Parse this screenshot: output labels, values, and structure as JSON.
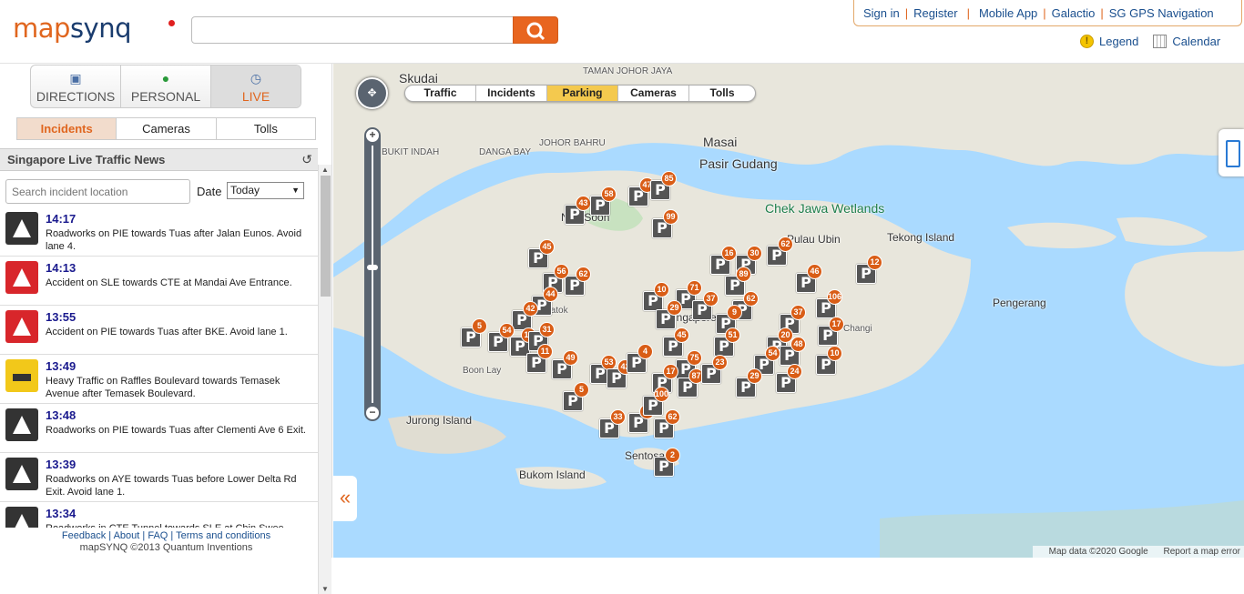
{
  "header": {
    "logo_part1": "map",
    "logo_part2": "synq",
    "search_placeholder": "",
    "links": [
      "Sign in",
      "Register",
      "Mobile App",
      "Galactio",
      "SG GPS Navigation"
    ],
    "legend_label": "Legend",
    "calendar_label": "Calendar"
  },
  "modes": [
    {
      "label": "DIRECTIONS",
      "icon": "car-icon"
    },
    {
      "label": "PERSONAL",
      "icon": "person-icon"
    },
    {
      "label": "LIVE",
      "icon": "clock-icon"
    }
  ],
  "subtabs": [
    "Incidents",
    "Cameras",
    "Tolls"
  ],
  "news": {
    "title": "Singapore Live Traffic News",
    "search_placeholder": "Search incident location",
    "date_label": "Date",
    "date_value": "Today"
  },
  "incidents": [
    {
      "time": "14:17",
      "type": "road",
      "icon": "roadworks-icon",
      "desc": "Roadworks on PIE towards Tuas after Jalan Eunos. Avoid lane 4."
    },
    {
      "time": "14:13",
      "type": "acc",
      "icon": "accident-icon",
      "desc": "Accident on SLE towards CTE at Mandai Ave Entrance."
    },
    {
      "time": "13:55",
      "type": "acc",
      "icon": "accident-icon",
      "desc": "Accident on PIE towards Tuas after BKE. Avoid lane 1."
    },
    {
      "time": "13:49",
      "type": "heavy",
      "icon": "heavy-traffic-icon",
      "desc": "Heavy Traffic on Raffles Boulevard towards Temasek Avenue after Temasek Boulevard."
    },
    {
      "time": "13:48",
      "type": "road",
      "icon": "roadworks-icon",
      "desc": "Roadworks on PIE towards Tuas after Clementi Ave 6 Exit."
    },
    {
      "time": "13:39",
      "type": "road",
      "icon": "roadworks-icon",
      "desc": "Roadworks on AYE towards Tuas before Lower Delta Rd Exit. Avoid lane 1."
    },
    {
      "time": "13:34",
      "type": "road",
      "icon": "roadworks-icon",
      "desc": "Roadworks in CTE Tunnel towards SLE at Chin Swee"
    }
  ],
  "footer": {
    "links": [
      "Feedback",
      "About",
      "FAQ",
      "Terms and conditions"
    ],
    "copyright": "mapSYNQ ©2013 Quantum Inventions"
  },
  "map": {
    "layers": [
      "Traffic",
      "Incidents",
      "Parking",
      "Cameras",
      "Tolls"
    ],
    "active_layer": "Parking",
    "places": [
      "Skudai",
      "TAMAN JOHOR JAYA",
      "Masai",
      "Pasir Gudang",
      "BUKIT INDAH",
      "DANGA BAY",
      "JOHOR BAHRU",
      "Chek Jawa Wetlands",
      "Pulau Ubin",
      "Tekong Island",
      "Pengerang",
      "Jurong Island",
      "Bukom Island",
      "Sentosa",
      "Nee Soon",
      "Singapore",
      "Changi",
      "Batok",
      "Boon Lay"
    ],
    "attribution": "Map data ©2020 Google",
    "report": "Report a map error",
    "parking_counts": [
      "43",
      "58",
      "47",
      "85",
      "99",
      "45",
      "62",
      "56",
      "44",
      "42",
      "5",
      "54",
      "19",
      "31",
      "11",
      "49",
      "53",
      "42",
      "5",
      "33",
      "29",
      "16",
      "30",
      "62",
      "89",
      "10",
      "71",
      "37",
      "62",
      "29",
      "9",
      "51",
      "45",
      "4",
      "75",
      "17",
      "87",
      "23",
      "100",
      "62",
      "2",
      "46",
      "12",
      "106",
      "37",
      "20",
      "48",
      "17",
      "10",
      "54",
      "24",
      "29"
    ]
  }
}
